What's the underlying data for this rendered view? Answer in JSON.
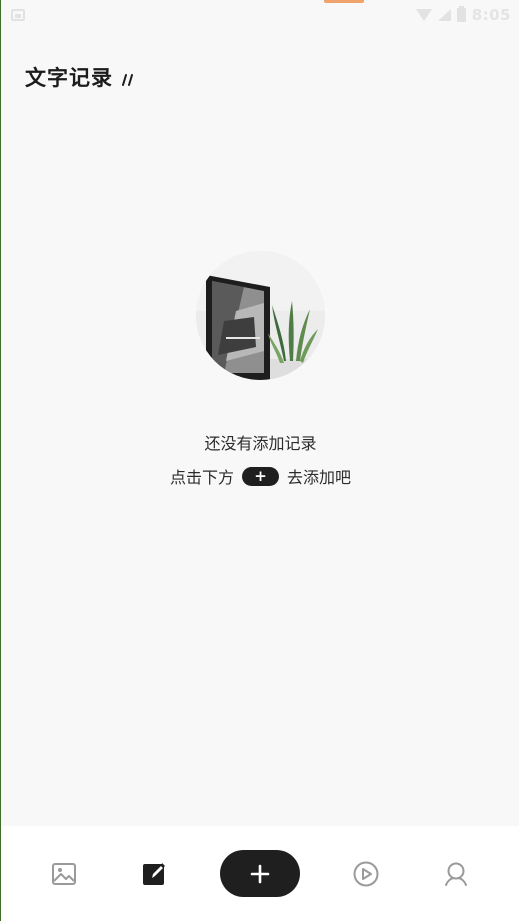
{
  "status_bar": {
    "time": "8:05"
  },
  "header": {
    "title": "文字记录"
  },
  "empty_state": {
    "line1": "还没有添加记录",
    "line2_before": "点击下方",
    "line2_badge": "+",
    "line2_after": "去添加吧"
  },
  "bottom_nav": {
    "items": [
      {
        "name": "gallery",
        "icon": "image-icon"
      },
      {
        "name": "text",
        "icon": "edit-note-icon"
      },
      {
        "name": "add",
        "icon": "plus-icon"
      },
      {
        "name": "video",
        "icon": "play-circle-icon"
      },
      {
        "name": "profile",
        "icon": "user-icon"
      }
    ],
    "active": "text"
  },
  "colors": {
    "background": "#f8f8f8",
    "primary_dark": "#1f1f1f",
    "icon_inactive": "#9a9a9a"
  }
}
